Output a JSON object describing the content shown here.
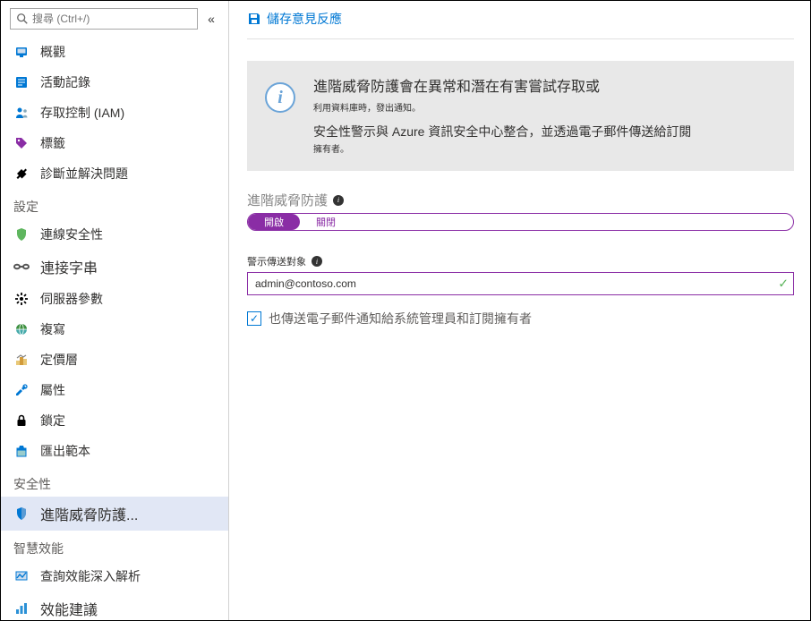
{
  "search": {
    "placeholder": "搜尋 (Ctrl+/)"
  },
  "nav": {
    "top": [
      {
        "id": "overview",
        "label": "概觀"
      },
      {
        "id": "activity",
        "label": "活動記錄"
      },
      {
        "id": "iam",
        "label": "存取控制 (IAM)"
      },
      {
        "id": "tags",
        "label": "標籤"
      },
      {
        "id": "diagnose",
        "label": "診斷並解決問題"
      }
    ],
    "sections": [
      {
        "title": "設定",
        "items": [
          {
            "id": "conn-security",
            "label": "連線安全性"
          },
          {
            "id": "conn-string",
            "label": "連接字串",
            "heavy": true
          },
          {
            "id": "server-params",
            "label": "伺服器參數"
          },
          {
            "id": "replication",
            "label": "複寫"
          },
          {
            "id": "pricing",
            "label": "定價層"
          },
          {
            "id": "properties",
            "label": "屬性"
          },
          {
            "id": "locks",
            "label": "鎖定"
          },
          {
            "id": "export",
            "label": "匯出範本"
          }
        ]
      },
      {
        "title": "安全性",
        "items": [
          {
            "id": "atp",
            "label": "進階威脅防護...",
            "heavy": true,
            "active": true
          }
        ]
      },
      {
        "title": "智慧效能",
        "items": [
          {
            "id": "query-perf",
            "label": "查詢效能深入解析"
          },
          {
            "id": "perf-rec",
            "label": "效能建議",
            "heavy": true
          }
        ]
      }
    ]
  },
  "toolbar": {
    "save_label": "儲存意見反應"
  },
  "info": {
    "line1": "進階威脅防護會在異常和潛在有害嘗試存取或",
    "line1_sub": "利用資料庫時，發出通知。",
    "line2": "安全性警示與 Azure 資訊安全中心整合，並透過電子郵件傳送給訂閱",
    "line2_sub": "擁有者。"
  },
  "atp_toggle": {
    "label": "進階威脅防護",
    "on": "開啟",
    "off": "關閉"
  },
  "alerts_to": {
    "label": "警示傳送對象",
    "value": "admin@contoso.com"
  },
  "also_email": {
    "label": "也傳送電子郵件通知給系統管理員和訂閱擁有者",
    "checked": true
  },
  "icons": {
    "overview": "#0078d4",
    "activity": "#0078d4",
    "iam": "#0078d4",
    "tags": "#8a2da5",
    "diagnose": "#000",
    "conn-security": "#5fb65f",
    "conn-string": "#555",
    "server-params": "#000",
    "replication": "#0078d4",
    "pricing": "#d29b3a",
    "properties": "#0078d4",
    "locks": "#000",
    "export": "#0078d4",
    "atp": "#0078d4",
    "query-perf": "#0078d4",
    "perf-rec": "#2a90d6"
  }
}
